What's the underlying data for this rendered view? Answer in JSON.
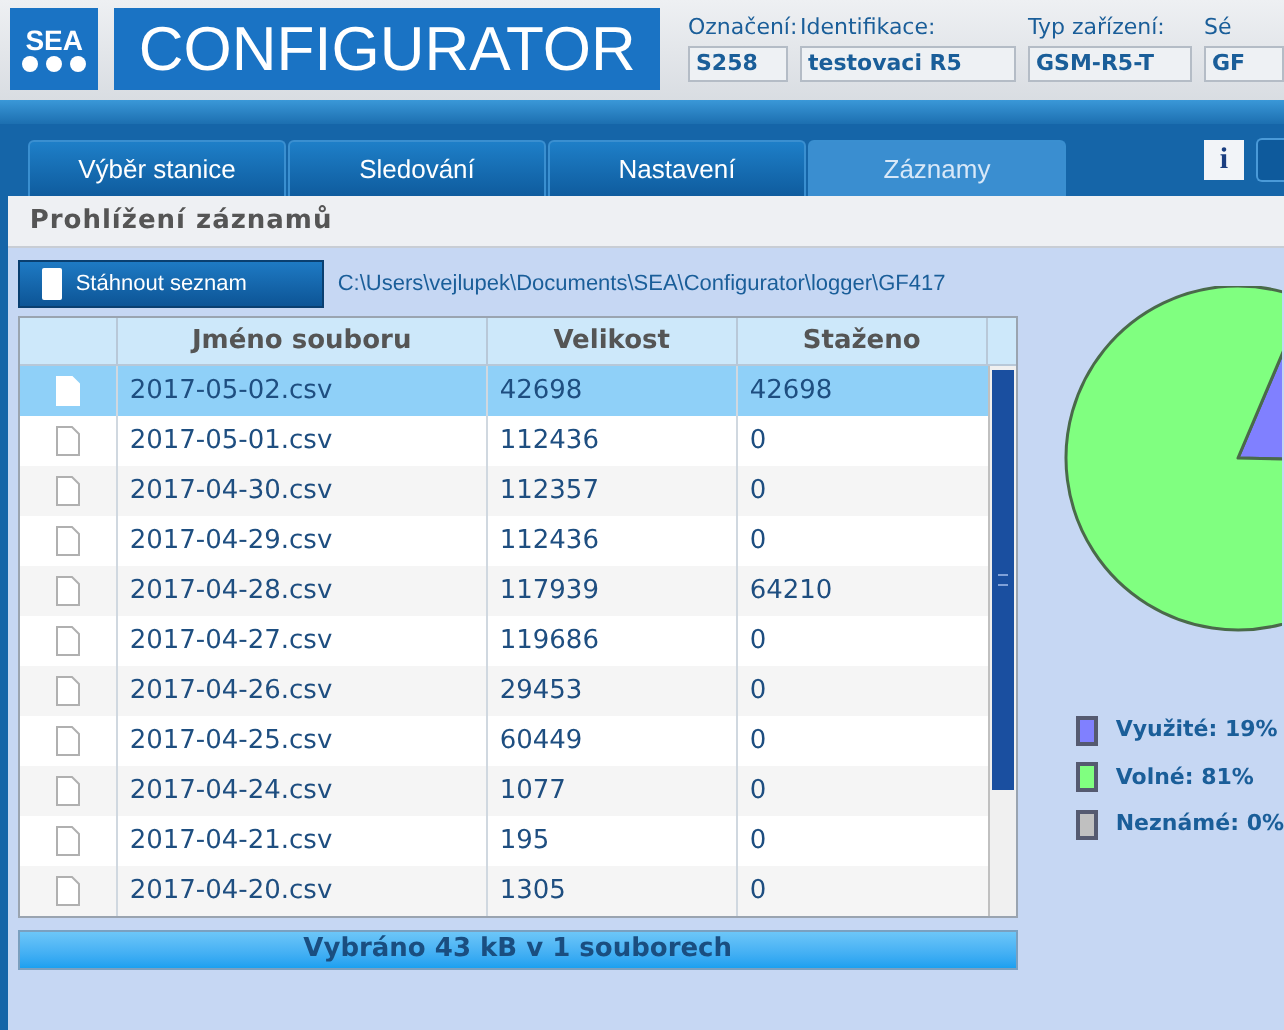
{
  "header": {
    "logo_mark": "SEA",
    "logo_text": "CONFIGURATOR",
    "fields": [
      {
        "label": "Označení:",
        "value": "S258"
      },
      {
        "label": "Identifikace:",
        "value": "testovaci R5"
      },
      {
        "label": "Typ zařízení:",
        "value": "GSM-R5-T"
      },
      {
        "label": "Sé",
        "value": "GF"
      }
    ]
  },
  "tabs": [
    {
      "label": "Výběr stanice",
      "selected": false
    },
    {
      "label": "Sledování",
      "selected": false
    },
    {
      "label": "Nastavení",
      "selected": false
    },
    {
      "label": "Záznamy",
      "selected": true
    }
  ],
  "info_button": "i",
  "panel": {
    "title": "Prohlížení záznamů",
    "download_button": "Stáhnout seznam",
    "path": "C:\\Users\\vejlupek\\Documents\\SEA\\Configurator\\logger\\GF417"
  },
  "table": {
    "columns": [
      "Jméno souboru",
      "Velikost",
      "Staženo"
    ],
    "rows": [
      {
        "name": "2017-05-02.csv",
        "size": "42698",
        "downloaded": "42698",
        "selected": true
      },
      {
        "name": "2017-05-01.csv",
        "size": "112436",
        "downloaded": "0",
        "selected": false
      },
      {
        "name": "2017-04-30.csv",
        "size": "112357",
        "downloaded": "0",
        "selected": false
      },
      {
        "name": "2017-04-29.csv",
        "size": "112436",
        "downloaded": "0",
        "selected": false
      },
      {
        "name": "2017-04-28.csv",
        "size": "117939",
        "downloaded": "64210",
        "selected": false
      },
      {
        "name": "2017-04-27.csv",
        "size": "119686",
        "downloaded": "0",
        "selected": false
      },
      {
        "name": "2017-04-26.csv",
        "size": "29453",
        "downloaded": "0",
        "selected": false
      },
      {
        "name": "2017-04-25.csv",
        "size": "60449",
        "downloaded": "0",
        "selected": false
      },
      {
        "name": "2017-04-24.csv",
        "size": "1077",
        "downloaded": "0",
        "selected": false
      },
      {
        "name": "2017-04-21.csv",
        "size": "195",
        "downloaded": "0",
        "selected": false
      },
      {
        "name": "2017-04-20.csv",
        "size": "1305",
        "downloaded": "0",
        "selected": false
      }
    ]
  },
  "status_bar": "Vybráno 43 kB v 1 souborech",
  "storage": {
    "chart_data": {
      "type": "pie",
      "values": [
        19,
        81,
        0
      ]
    },
    "legend": [
      {
        "label": "Využité: 19%",
        "color": "#8080ff"
      },
      {
        "label": "Volné: 81%",
        "color": "#80ff80"
      },
      {
        "label": "Neznámé: 0%",
        "color": "#c0c0c0"
      }
    ]
  }
}
